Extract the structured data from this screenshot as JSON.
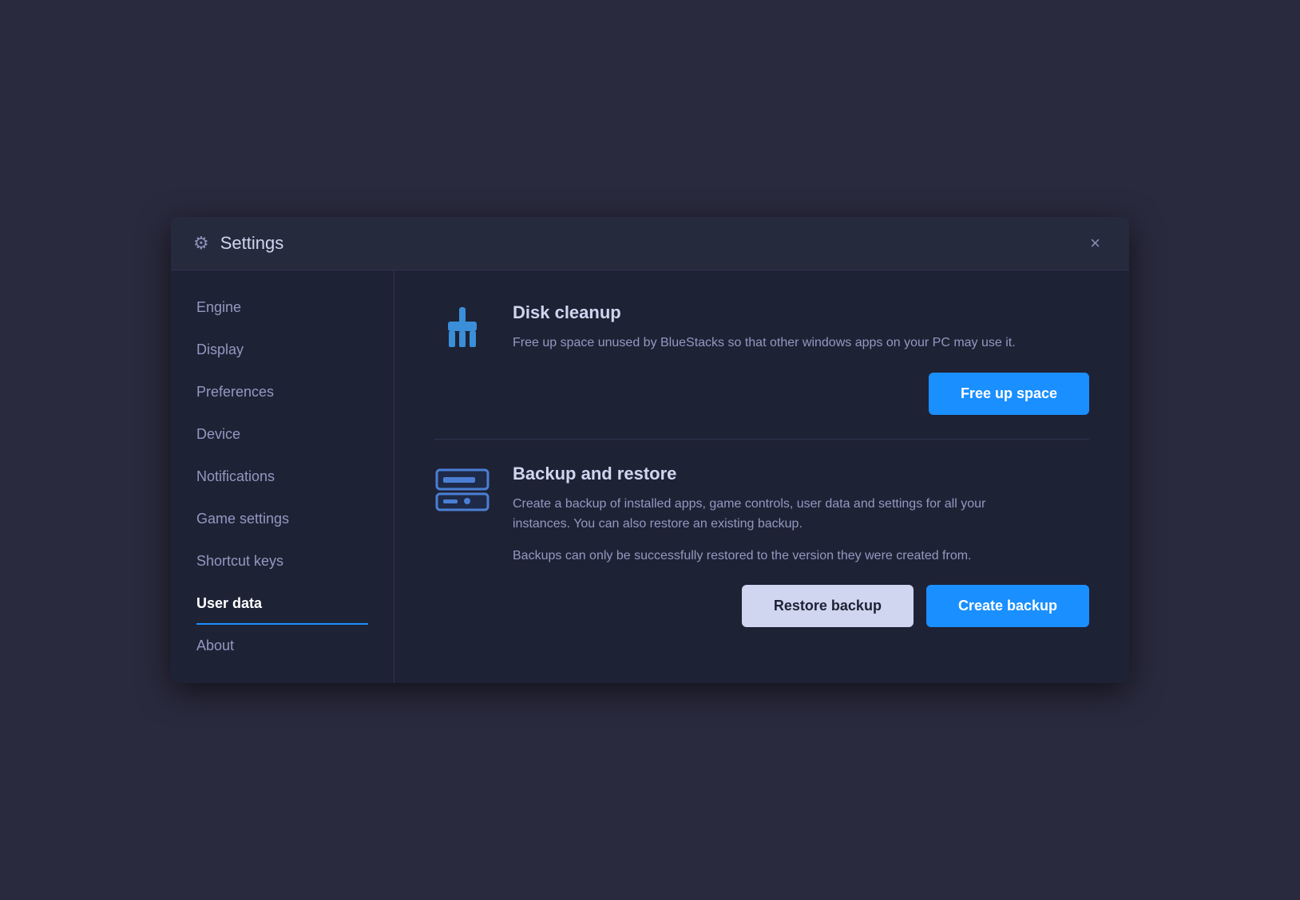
{
  "dialog": {
    "title": "Settings",
    "close_label": "×"
  },
  "sidebar": {
    "items": [
      {
        "id": "engine",
        "label": "Engine",
        "active": false
      },
      {
        "id": "display",
        "label": "Display",
        "active": false
      },
      {
        "id": "preferences",
        "label": "Preferences",
        "active": false
      },
      {
        "id": "device",
        "label": "Device",
        "active": false
      },
      {
        "id": "notifications",
        "label": "Notifications",
        "active": false
      },
      {
        "id": "game-settings",
        "label": "Game settings",
        "active": false
      },
      {
        "id": "shortcut-keys",
        "label": "Shortcut keys",
        "active": false
      },
      {
        "id": "user-data",
        "label": "User data",
        "active": true
      },
      {
        "id": "about",
        "label": "About",
        "active": false
      }
    ]
  },
  "main": {
    "disk_cleanup": {
      "title": "Disk cleanup",
      "description": "Free up space unused by BlueStacks so that other windows apps on your PC may use it.",
      "button_label": "Free up space"
    },
    "backup_restore": {
      "title": "Backup and restore",
      "description": "Create a backup of installed apps, game controls, user data and settings for all your instances. You can also restore an existing backup.",
      "warning": "Backups can only be successfully restored to the version they were created from.",
      "restore_label": "Restore backup",
      "create_label": "Create backup"
    }
  },
  "icons": {
    "gear": "⚙",
    "close": "✕"
  }
}
